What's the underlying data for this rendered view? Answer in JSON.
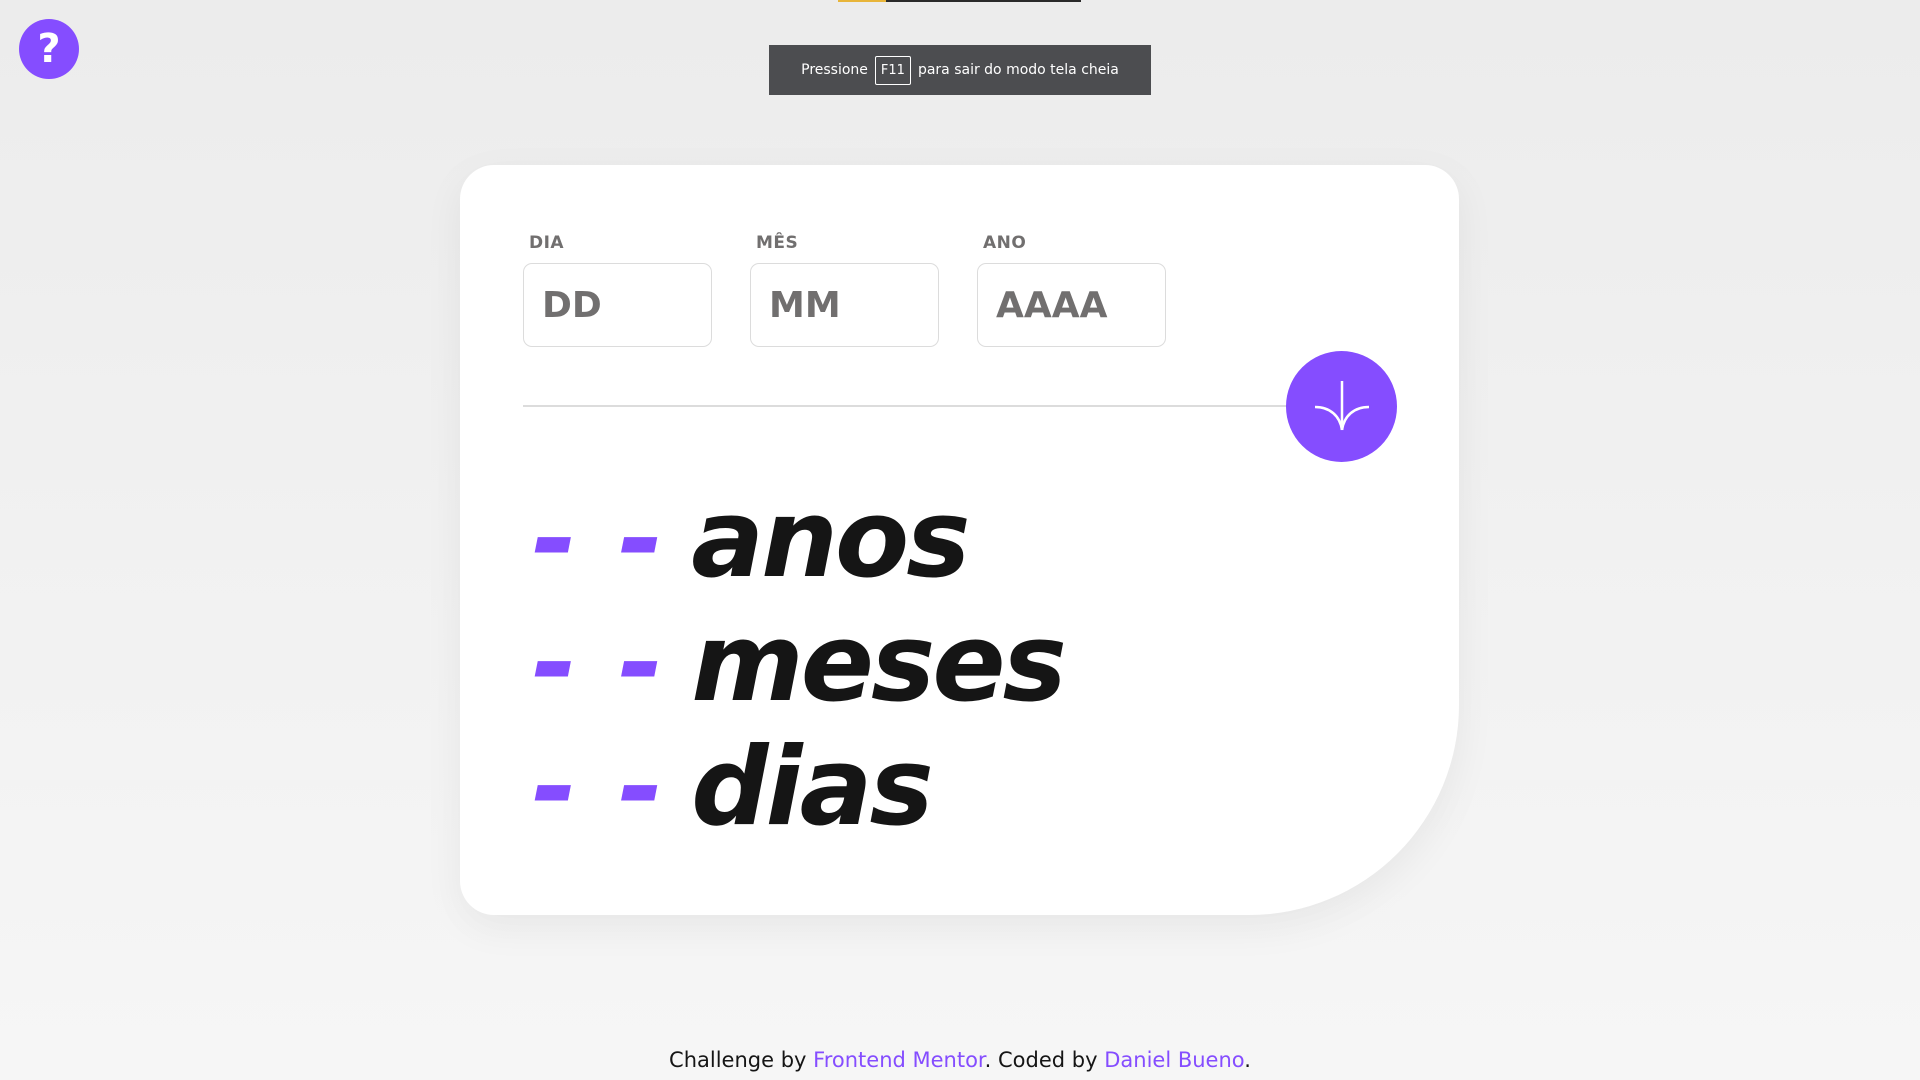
{
  "help_button": {
    "label": "?",
    "icon": "question-icon"
  },
  "fullscreen_notice": {
    "prefix": "Pressione",
    "key": "F11",
    "suffix": "para sair do modo tela cheia"
  },
  "form": {
    "day": {
      "label": "DIA",
      "placeholder": "DD",
      "value": ""
    },
    "month": {
      "label": "MÊS",
      "placeholder": "MM",
      "value": ""
    },
    "year": {
      "label": "ANO",
      "placeholder": "AAAA",
      "value": ""
    },
    "submit_icon": "arrow-down-icon"
  },
  "results": {
    "years": {
      "value": "- -",
      "unit": "anos"
    },
    "months": {
      "value": "- -",
      "unit": "meses"
    },
    "days": {
      "value": "- -",
      "unit": "dias"
    }
  },
  "footer": {
    "prefix": "Challenge by ",
    "link1": "Frontend Mentor",
    "middle": ". Coded by ",
    "link2": "Daniel Bueno",
    "suffix": "."
  },
  "colors": {
    "accent": "#854dff",
    "text_dark": "#151515",
    "label_gray": "#716f6f",
    "border": "#dcdcdc"
  }
}
